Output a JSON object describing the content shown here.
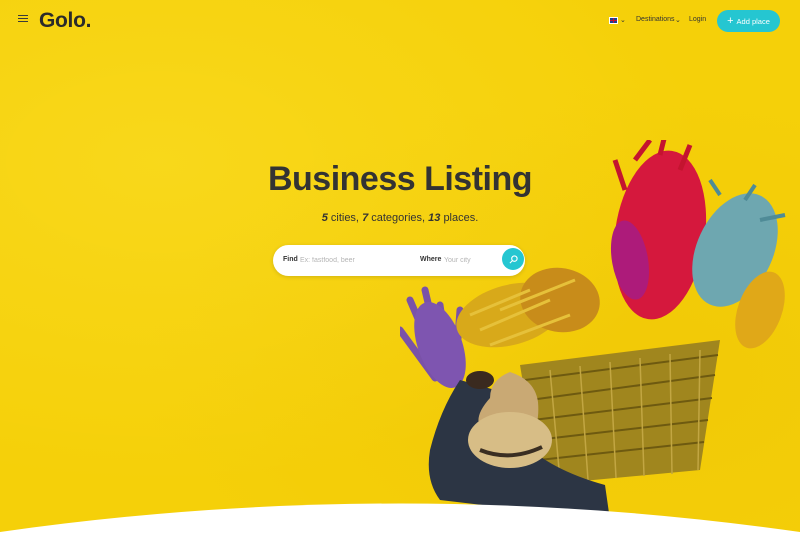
{
  "header": {
    "logo": "Golo.",
    "language_icon": "uk-flag-icon",
    "destinations_label": "Destinations",
    "login_label": "Login",
    "add_place_label": "Add place"
  },
  "hero": {
    "title": "Business Listing",
    "stats": {
      "cities_count": "5",
      "cities_label": "cities,",
      "categories_count": "7",
      "categories_label": "categories,",
      "places_count": "13",
      "places_label": "places."
    }
  },
  "search": {
    "find_label": "Find",
    "find_placeholder": "Ex: fastfood, beer",
    "where_label": "Where",
    "where_placeholder": "Your city",
    "button_icon": "search-icon"
  },
  "colors": {
    "background": "#f5d009",
    "accent": "#25c6d1",
    "text": "#333333"
  }
}
